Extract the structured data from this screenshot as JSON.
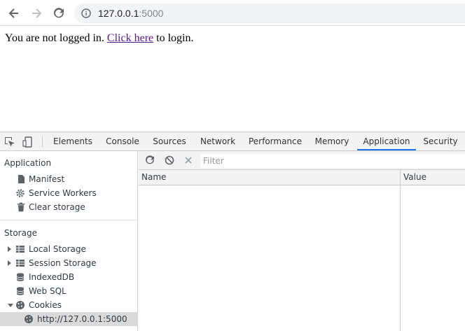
{
  "browser": {
    "url_host": "127.0.0.1",
    "url_port": ":5000"
  },
  "page": {
    "text_before": "You are not logged in. ",
    "link_text": "Click here",
    "text_after": " to login."
  },
  "devtools": {
    "tabs": [
      {
        "label": "Elements",
        "active": false
      },
      {
        "label": "Console",
        "active": false
      },
      {
        "label": "Sources",
        "active": false
      },
      {
        "label": "Network",
        "active": false
      },
      {
        "label": "Performance",
        "active": false
      },
      {
        "label": "Memory",
        "active": false
      },
      {
        "label": "Application",
        "active": true
      },
      {
        "label": "Security",
        "active": false
      }
    ],
    "active_tab_color": "#1a73e8",
    "sidebar": {
      "application_section": "Application",
      "application_items": [
        {
          "label": "Manifest",
          "icon": "document-icon"
        },
        {
          "label": "Service Workers",
          "icon": "gear-icon"
        },
        {
          "label": "Clear storage",
          "icon": "trash-icon"
        }
      ],
      "storage_section": "Storage",
      "storage_items": [
        {
          "label": "Local Storage",
          "icon": "grid-icon",
          "expand": "collapsed"
        },
        {
          "label": "Session Storage",
          "icon": "grid-icon",
          "expand": "collapsed"
        },
        {
          "label": "IndexedDB",
          "icon": "database-icon",
          "expand": "none"
        },
        {
          "label": "Web SQL",
          "icon": "database-icon",
          "expand": "none"
        },
        {
          "label": "Cookies",
          "icon": "cookie-icon",
          "expand": "expanded"
        },
        {
          "label": "http://127.0.0.1:5000",
          "icon": "cookie-icon",
          "expand": "none",
          "selected": true
        }
      ]
    },
    "main": {
      "filter_placeholder": "Filter",
      "columns": [
        "Name",
        "Value"
      ]
    }
  }
}
